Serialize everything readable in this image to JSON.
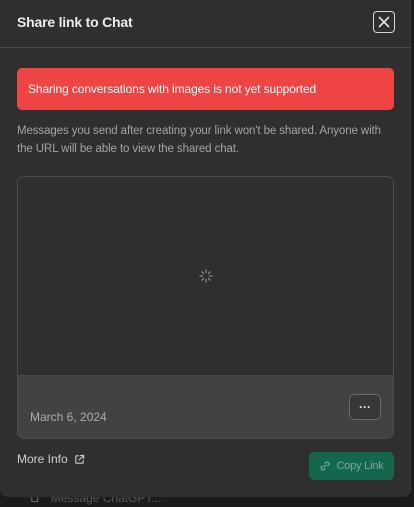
{
  "dialog": {
    "title": "Share link to Chat",
    "close_icon": "close-icon"
  },
  "alert": {
    "message": "Sharing conversations with images is not yet supported",
    "color": "#ef4444"
  },
  "description": "Messages you send after creating your link won't be shared. Anyone with the URL will be able to view the shared chat.",
  "preview": {
    "loading_icon": "spinner-icon",
    "date": "March 6, 2024",
    "more_label": "···"
  },
  "footer": {
    "more_info_label": "More Info",
    "more_info_icon": "external-link-icon",
    "copy_link_label": "Copy Link",
    "copy_link_icon": "link-icon",
    "copy_button_color": "#14664f"
  },
  "background": {
    "composer_placeholder": "Message ChatGPT..."
  }
}
